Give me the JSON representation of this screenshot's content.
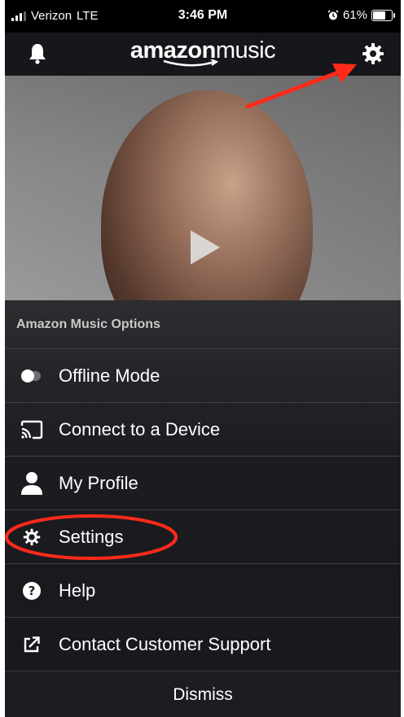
{
  "status_bar": {
    "carrier": "Verizon",
    "network": "LTE",
    "time": "3:46 PM",
    "battery": "61%",
    "battery_level": 0.61
  },
  "header": {
    "logo_bold": "amazon",
    "logo_light": "music",
    "bell_icon": "bell-icon",
    "settings_icon": "gear-icon"
  },
  "hero": {
    "play_icon": "play-icon"
  },
  "options": {
    "title": "Amazon Music Options",
    "items": [
      {
        "icon": "toggle-icon",
        "label": "Offline Mode"
      },
      {
        "icon": "cast-icon",
        "label": "Connect to a Device"
      },
      {
        "icon": "person-icon",
        "label": "My Profile"
      },
      {
        "icon": "gear-icon",
        "label": "Settings"
      },
      {
        "icon": "help-icon",
        "label": "Help"
      },
      {
        "icon": "external-link-icon",
        "label": "Contact Customer Support"
      }
    ],
    "dismiss": "Dismiss"
  },
  "annotation_color": "#ff2a1a"
}
